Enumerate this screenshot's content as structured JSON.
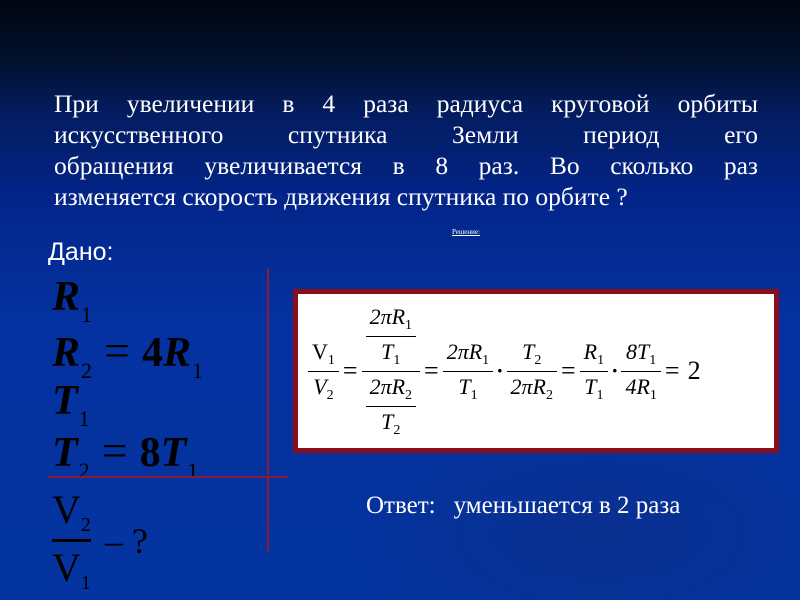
{
  "slide": {
    "background_color": "#0432a0",
    "accent_line_color": "#8a1a3a",
    "box_border_color": "#8b0d1a"
  },
  "problem": {
    "lines": [
      "При увеличении в 4 раза радиуса круговой орбиты",
      "искусственного спутника Земли период его",
      "обращения увеличивается в 8 раз. Во сколько раз",
      "изменяется скорость движения спутника по орбите ?"
    ]
  },
  "solution_label": "Решение:",
  "given": {
    "label": "Дано:",
    "items": [
      {
        "var": "R",
        "sub": "1"
      },
      {
        "var": "R",
        "sub": "2",
        "op": "=",
        "coef": "4",
        "rhs_var": "R",
        "rhs_sub": "1"
      },
      {
        "var": "T",
        "sub": "1"
      },
      {
        "var": "T",
        "sub": "2",
        "op": "=",
        "coef": "8",
        "rhs_var": "T",
        "rhs_sub": "1"
      }
    ],
    "unknown": {
      "num": "V",
      "num_sub": "2",
      "den": "V",
      "den_sub": "1",
      "tail": "– ?"
    }
  },
  "formula": {
    "lhs": {
      "num": "V",
      "num_sub": "1",
      "den": "V",
      "den_sub": "2"
    },
    "step1": {
      "top_num": "2πR",
      "top_num_sub": "1",
      "top_den": "T",
      "top_den_sub": "1",
      "bot_num": "2πR",
      "bot_num_sub": "2",
      "bot_den": "T",
      "bot_den_sub": "2"
    },
    "step2a": {
      "num": "2πR",
      "num_sub": "1",
      "den": "T",
      "den_sub": "1"
    },
    "step2b": {
      "num": "T",
      "num_sub": "2",
      "den": "2πR",
      "den_sub": "2"
    },
    "step3a": {
      "num": "R",
      "num_sub": "1",
      "den": "T",
      "den_sub": "1"
    },
    "step3b": {
      "num": "8T",
      "num_sub": "1",
      "den": "4R",
      "den_sub": "1"
    },
    "equals": "=",
    "dot": "·",
    "result": "2"
  },
  "answer": {
    "label": "Ответ:",
    "text": "уменьшается в 2 раза"
  }
}
